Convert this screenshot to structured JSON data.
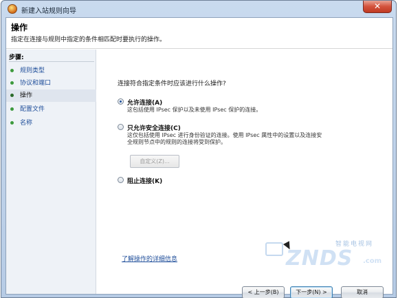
{
  "window": {
    "title": "新建入站规则向导",
    "close_glyph": "✕"
  },
  "header": {
    "title": "操作",
    "description": "指定在连接与规则中指定的条件相匹配时要执行的操作。"
  },
  "sidebar": {
    "steps_label": "步骤:",
    "items": [
      {
        "label": "规则类型",
        "current": false
      },
      {
        "label": "协议和端口",
        "current": false
      },
      {
        "label": "操作",
        "current": true
      },
      {
        "label": "配置文件",
        "current": false
      },
      {
        "label": "名称",
        "current": false
      }
    ]
  },
  "main": {
    "question": "连接符合指定条件时应该进行什么操作?",
    "options": [
      {
        "label": "允许连接(A)",
        "desc_lines": [
          "这包括使用 IPsec 保护以及未使用 IPsec 保护的连接。"
        ],
        "selected": true
      },
      {
        "label": "只允许安全连接(C)",
        "desc_lines": [
          "这仅包括使用 IPsec 进行身份验证的连接。使用 IPsec 属性中的设置以及连接安",
          "全规则节点中的规则的连接将受到保护。"
        ],
        "selected": false
      },
      {
        "label": "阻止连接(K)",
        "desc_lines": [],
        "selected": false
      }
    ],
    "customize_label": "自定义(Z)...",
    "learn_more": "了解操作的详细信息"
  },
  "footer": {
    "back_label": "< 上一步(B)",
    "next_label": "下一步(N) >",
    "cancel_label": "取消"
  },
  "watermark": {
    "top": "智能电视网",
    "brand": "ZNDS",
    "suffix": ".com"
  },
  "colors": {
    "link": "#1f4e9a",
    "step_dot": "#3d9a3d",
    "sidebar_bg": "#eef2f7",
    "title_bar": "#b6cbe5"
  }
}
